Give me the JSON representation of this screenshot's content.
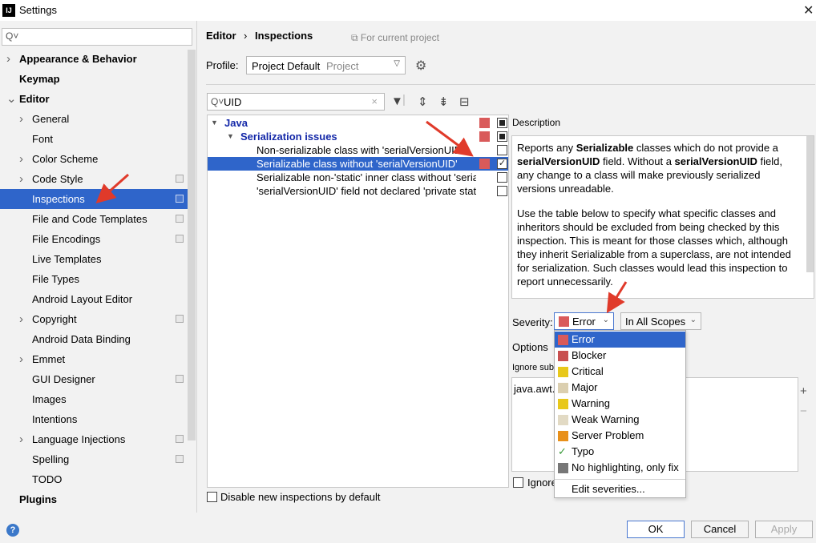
{
  "window": {
    "title": "Settings",
    "app_icon": "IJ"
  },
  "sidebar": {
    "search_placeholder": "",
    "items": [
      {
        "label": "Appearance & Behavior",
        "bold": true,
        "arrow": "›"
      },
      {
        "label": "Keymap",
        "bold": true
      },
      {
        "label": "Editor",
        "bold": true,
        "arrow": "⌄"
      },
      {
        "label": "General",
        "arrow": "›"
      },
      {
        "label": "Font"
      },
      {
        "label": "Color Scheme",
        "arrow": "›"
      },
      {
        "label": "Code Style",
        "arrow": "›"
      },
      {
        "label": "Inspections",
        "selected": true
      },
      {
        "label": "File and Code Templates"
      },
      {
        "label": "File Encodings"
      },
      {
        "label": "Live Templates"
      },
      {
        "label": "File Types"
      },
      {
        "label": "Android Layout Editor"
      },
      {
        "label": "Copyright",
        "arrow": "›"
      },
      {
        "label": "Android Data Binding"
      },
      {
        "label": "Emmet",
        "arrow": "›"
      },
      {
        "label": "GUI Designer"
      },
      {
        "label": "Images"
      },
      {
        "label": "Intentions"
      },
      {
        "label": "Language Injections",
        "arrow": "›"
      },
      {
        "label": "Spelling"
      },
      {
        "label": "TODO"
      },
      {
        "label": "Plugins",
        "bold": true
      }
    ]
  },
  "header": {
    "breadcrumb_1": "Editor",
    "breadcrumb_sep": "›",
    "breadcrumb_2": "Inspections",
    "scope_note": "For current project",
    "profile_label": "Profile:",
    "profile_value": "Project Default",
    "profile_kind": "Project"
  },
  "filter": {
    "value": "UID"
  },
  "tree": {
    "java": "Java",
    "group": "Serialization issues",
    "items": [
      "Non-serializable class with 'serialVersionUID'",
      "Serializable class without 'serialVersionUID'",
      "Serializable non-'static' inner class without 'serialVersionUID'",
      "'serialVersionUID' field not declared 'private static final long'"
    ]
  },
  "disable_new_label": "Disable new inspections by default",
  "description": {
    "title": "Description",
    "p1_a": "Reports any ",
    "p1_b": "Serializable",
    "p1_c": " classes which do not provide a ",
    "p1_d": "serialVersionUID",
    "p1_e": " field. Without a ",
    "p1_f": "serialVersionUID",
    "p1_g": " field, any change to a class will make previously serialized versions unreadable.",
    "p2": "Use the table below to specify what specific classes and inheritors should be excluded from being checked by this inspection. This is meant for those classes which, although they inherit Serializable from a superclass, are not intended for serialization. Such classes would lead this inspection to report unnecessarily."
  },
  "severity": {
    "label": "Severity:",
    "value": "Error",
    "scope": "In All Scopes"
  },
  "options_label": "Options",
  "ignore_label": "Ignore sub",
  "ignore_value": "java.awt.",
  "ignore_checkbox_label": "Ignore",
  "severity_options": [
    {
      "label": "Error",
      "color": "#d95a5a",
      "highlighted": true
    },
    {
      "label": "Blocker",
      "color": "#c85050"
    },
    {
      "label": "Critical",
      "color": "#e8c81a"
    },
    {
      "label": "Major",
      "color": "#dbcfb0"
    },
    {
      "label": "Warning",
      "color": "#e8c81a"
    },
    {
      "label": "Weak Warning",
      "color": "#e2dac4"
    },
    {
      "label": "Server Problem",
      "color": "#e8901a"
    },
    {
      "label": "Typo",
      "color": "typo-check"
    },
    {
      "label": "No highlighting, only fix",
      "color": "#777777"
    }
  ],
  "edit_severities": "Edit severities...",
  "buttons": {
    "ok": "OK",
    "cancel": "Cancel",
    "apply": "Apply",
    "help": "?"
  }
}
